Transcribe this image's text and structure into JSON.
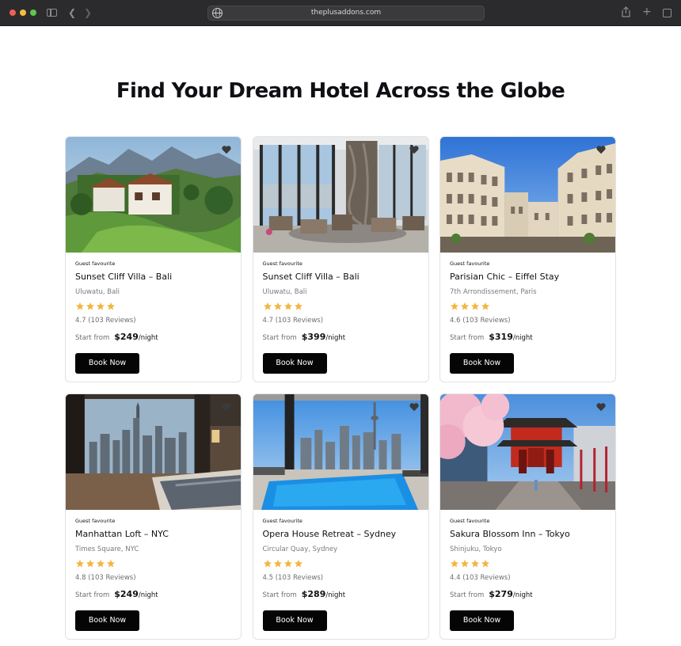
{
  "browser": {
    "url": "theplusaddons.com",
    "icons": [
      "sidebar-icon",
      "back-icon",
      "forward-icon",
      "globe-icon",
      "share-icon",
      "plus-icon",
      "tabs-icon"
    ]
  },
  "page": {
    "title": "Find Your Dream Hotel Across the Globe"
  },
  "colors": {
    "star": "#f4b53f",
    "button_bg": "#050505",
    "button_text": "#ffffff"
  },
  "cards": [
    {
      "badge": "Guest favourite",
      "name": "Sunset Cliff Villa – Bali",
      "location": "Uluwatu, Bali",
      "stars": 4,
      "rating": "4.7 (103 Reviews)",
      "price_prefix": "Start from",
      "price": "$249",
      "per_night": "/night",
      "button": "Book Now"
    },
    {
      "badge": "Guest favourite",
      "name": "Sunset Cliff Villa – Bali",
      "location": "Uluwatu, Bali",
      "stars": 4,
      "rating": "4.7 (103 Reviews)",
      "price_prefix": "Start from",
      "price": "$399",
      "per_night": "/night",
      "button": "Book Now"
    },
    {
      "badge": "Guest favourite",
      "name": "Parisian Chic – Eiffel Stay",
      "location": "7th Arrondissement, Paris",
      "stars": 4,
      "rating": "4.6 (103 Reviews)",
      "price_prefix": "Start from",
      "price": "$319",
      "per_night": "/night",
      "button": "Book Now"
    },
    {
      "badge": "Guest favourite",
      "name": "Manhattan Loft – NYC",
      "location": "Times Square, NYC",
      "stars": 4,
      "rating": "4.8 (103 Reviews)",
      "price_prefix": "Start from",
      "price": "$249",
      "per_night": "/night",
      "button": "Book Now"
    },
    {
      "badge": "Guest favourite",
      "name": "Opera House Retreat – Sydney",
      "location": "Circular Quay, Sydney",
      "stars": 4,
      "rating": "4.5 (103 Reviews)",
      "price_prefix": "Start from",
      "price": "$289",
      "per_night": "/night",
      "button": "Book Now"
    },
    {
      "badge": "Guest favourite",
      "name": "Sakura Blossom Inn – Tokyo",
      "location": "Shinjuku, Tokyo",
      "stars": 4,
      "rating": "4.4 (103 Reviews)",
      "price_prefix": "Start from",
      "price": "$279",
      "per_night": "/night",
      "button": "Book Now"
    }
  ]
}
